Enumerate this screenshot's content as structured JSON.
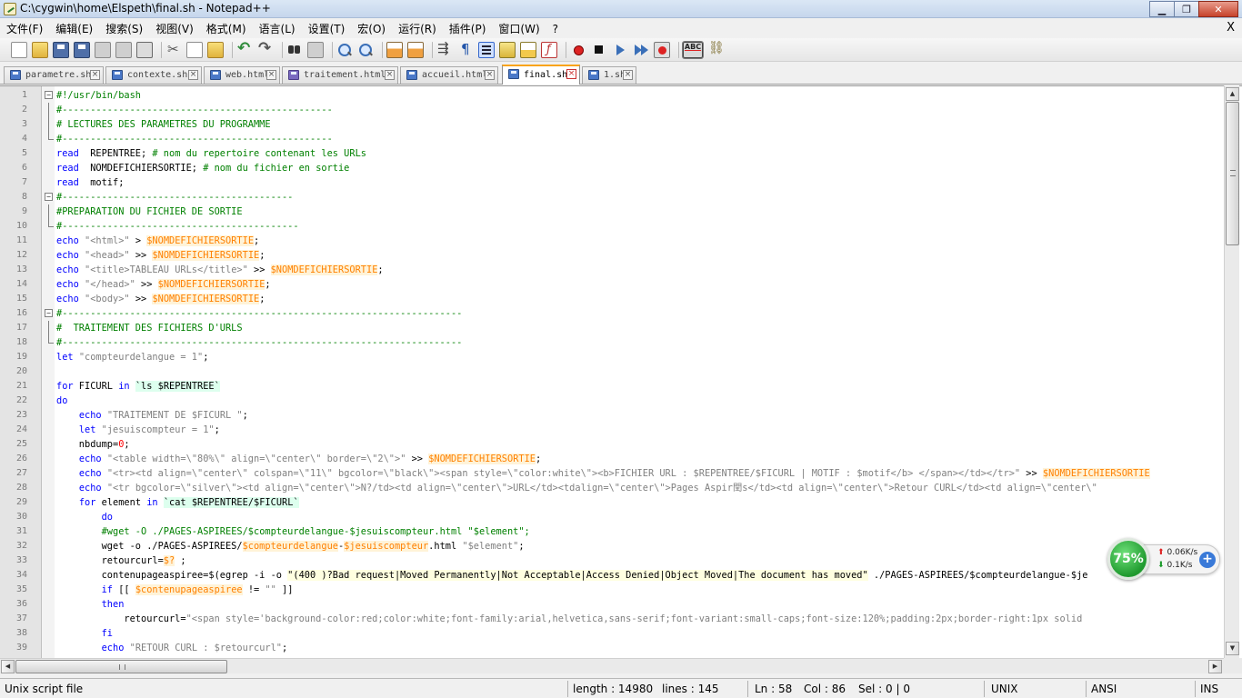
{
  "window": {
    "title": "C:\\cygwin\\home\\Elspeth\\final.sh - Notepad++",
    "minimize_label": "▁",
    "restore_label": "❐",
    "close_label": "✕"
  },
  "menu": {
    "items": [
      "文件(F)",
      "编辑(E)",
      "搜索(S)",
      "视图(V)",
      "格式(M)",
      "语言(L)",
      "设置(T)",
      "宏(O)",
      "运行(R)",
      "插件(P)",
      "窗口(W)",
      "?"
    ],
    "close_doc_label": "X"
  },
  "toolbar": {
    "spell_label": "ABC"
  },
  "tabs": [
    {
      "label": "parametre.sh",
      "active": false
    },
    {
      "label": "contexte.sh",
      "active": false
    },
    {
      "label": "web.html",
      "active": false
    },
    {
      "label": "traitement.html",
      "active": false
    },
    {
      "label": "accueil.html",
      "active": false
    },
    {
      "label": "final.sh",
      "active": true
    },
    {
      "label": "1.sh",
      "active": false
    }
  ],
  "editor": {
    "line_numbers": [
      "1",
      "2",
      "3",
      "4",
      "5",
      "6",
      "7",
      "8",
      "9",
      "10",
      "11",
      "12",
      "13",
      "14",
      "15",
      "16",
      "17",
      "18",
      "19",
      "20",
      "21",
      "22",
      "23",
      "24",
      "25",
      "26",
      "27",
      "28",
      "29",
      "30",
      "31",
      "32",
      "33",
      "34",
      "35",
      "36",
      "37",
      "38",
      "39"
    ],
    "lines": [
      [
        [
          "cm",
          "#!/usr/bin/bash"
        ]
      ],
      [
        [
          "cm",
          "#------------------------------------------------"
        ]
      ],
      [
        [
          "cm",
          "# LECTURES DES PARAMETRES DU PROGRAMME"
        ]
      ],
      [
        [
          "cm",
          "#------------------------------------------------"
        ]
      ],
      [
        [
          "kw",
          "read"
        ],
        [
          "",
          "  REPENTREE; "
        ],
        [
          "cm",
          "# nom du repertoire contenant les URLs"
        ]
      ],
      [
        [
          "kw",
          "read"
        ],
        [
          "",
          "  NOMDEFICHIERSORTIE; "
        ],
        [
          "cm",
          "# nom du fichier en sortie"
        ]
      ],
      [
        [
          "kw",
          "read"
        ],
        [
          "",
          "  motif;"
        ]
      ],
      [
        [
          "cm",
          "#-----------------------------------------"
        ]
      ],
      [
        [
          "cm",
          "#PREPARATION DU FICHIER DE SORTIE"
        ]
      ],
      [
        [
          "cm",
          "#------------------------------------------"
        ]
      ],
      [
        [
          "kw",
          "echo"
        ],
        [
          "",
          " "
        ],
        [
          "st",
          "\"<html>\""
        ],
        [
          "",
          " > "
        ],
        [
          "vr",
          "$NOMDEFICHIERSORTIE"
        ],
        [
          "",
          ";"
        ]
      ],
      [
        [
          "kw",
          "echo"
        ],
        [
          "",
          " "
        ],
        [
          "st",
          "\"<head>\""
        ],
        [
          "",
          " >> "
        ],
        [
          "vr",
          "$NOMDEFICHIERSORTIE"
        ],
        [
          "",
          ";"
        ]
      ],
      [
        [
          "kw",
          "echo"
        ],
        [
          "",
          " "
        ],
        [
          "st",
          "\"<title>TABLEAU URLs</title>\""
        ],
        [
          "",
          " >> "
        ],
        [
          "vr",
          "$NOMDEFICHIERSORTIE"
        ],
        [
          "",
          ";"
        ]
      ],
      [
        [
          "kw",
          "echo"
        ],
        [
          "",
          " "
        ],
        [
          "st",
          "\"</head>\""
        ],
        [
          "",
          " >> "
        ],
        [
          "vr",
          "$NOMDEFICHIERSORTIE"
        ],
        [
          "",
          ";"
        ]
      ],
      [
        [
          "kw",
          "echo"
        ],
        [
          "",
          " "
        ],
        [
          "st",
          "\"<body>\""
        ],
        [
          "",
          " >> "
        ],
        [
          "vr",
          "$NOMDEFICHIERSORTIE"
        ],
        [
          "",
          ";"
        ]
      ],
      [
        [
          "cm",
          "#-----------------------------------------------------------------------"
        ]
      ],
      [
        [
          "cm",
          "#  TRAITEMENT DES FICHIERS D'URLS"
        ]
      ],
      [
        [
          "cm",
          "#-----------------------------------------------------------------------"
        ]
      ],
      [
        [
          "kw",
          "let"
        ],
        [
          "",
          " "
        ],
        [
          "st",
          "\"compteurdelangue = 1\""
        ],
        [
          "",
          ";"
        ]
      ],
      [
        [
          "",
          ""
        ]
      ],
      [
        [
          "kw",
          "for"
        ],
        [
          "",
          " FICURL "
        ],
        [
          "kw",
          "in"
        ],
        [
          "",
          " "
        ],
        [
          "bt",
          "`ls $REPENTREE`"
        ]
      ],
      [
        [
          "kw",
          "do"
        ]
      ],
      [
        [
          "",
          "    "
        ],
        [
          "kw",
          "echo"
        ],
        [
          "",
          " "
        ],
        [
          "st",
          "\"TRAITEMENT DE $FICURL \""
        ],
        [
          "",
          ";"
        ]
      ],
      [
        [
          "",
          "    "
        ],
        [
          "kw",
          "let"
        ],
        [
          "",
          " "
        ],
        [
          "st",
          "\"jesuiscompteur = 1\""
        ],
        [
          "",
          ";"
        ]
      ],
      [
        [
          "",
          "    nbdump="
        ],
        [
          "nm",
          "0"
        ],
        [
          "",
          ";"
        ]
      ],
      [
        [
          "",
          "    "
        ],
        [
          "kw",
          "echo"
        ],
        [
          "",
          " "
        ],
        [
          "st",
          "\"<table width=\\\"80%\\\" align=\\\"center\\\" border=\\\"2\\\">\""
        ],
        [
          "",
          " >> "
        ],
        [
          "vr",
          "$NOMDEFICHIERSORTIE"
        ],
        [
          "",
          ";"
        ]
      ],
      [
        [
          "",
          "    "
        ],
        [
          "kw",
          "echo"
        ],
        [
          "",
          " "
        ],
        [
          "st",
          "\"<tr><td align=\\\"center\\\" colspan=\\\"11\\\" bgcolor=\\\"black\\\"><span style=\\\"color:white\\\"><b>FICHIER URL : $REPENTREE/$FICURL | MOTIF : $motif</b> </span></td></tr>\""
        ],
        [
          "",
          " >> "
        ],
        [
          "vr",
          "$NOMDEFICHIERSORTIE"
        ]
      ],
      [
        [
          "",
          "    "
        ],
        [
          "kw",
          "echo"
        ],
        [
          "",
          " "
        ],
        [
          "st",
          "\"<tr bgcolor=\\\"silver\\\"><td align=\\\"center\\\">N?/td><td align=\\\"center\\\">URL</td><tdalign=\\\"center\\\">Pages Aspir閏s</td><td align=\\\"center\\\">Retour CURL</td><td align=\\\"center\\\""
        ]
      ],
      [
        [
          "",
          "    "
        ],
        [
          "kw",
          "for"
        ],
        [
          "",
          " element "
        ],
        [
          "kw",
          "in"
        ],
        [
          "",
          " "
        ],
        [
          "bt",
          "`cat $REPENTREE/$FICURL`"
        ]
      ],
      [
        [
          "",
          "        "
        ],
        [
          "kw",
          "do"
        ]
      ],
      [
        [
          "",
          "        "
        ],
        [
          "cm",
          "#wget -O ./PAGES-ASPIREES/$compteurdelangue-$jesuiscompteur.html \"$element\";"
        ]
      ],
      [
        [
          "",
          "        wget -o ./PAGES-ASPIREES/"
        ],
        [
          "vr",
          "$compteurdelangue"
        ],
        [
          "",
          "-"
        ],
        [
          "vr",
          "$jesuiscompteur"
        ],
        [
          "",
          ".html "
        ],
        [
          "st",
          "\"$element\""
        ],
        [
          "",
          ";"
        ]
      ],
      [
        [
          "",
          "        retourcurl="
        ],
        [
          "vr",
          "$?"
        ],
        [
          "",
          " ;"
        ]
      ],
      [
        [
          "",
          "        contenupageaspiree=$(egrep -i -o "
        ],
        [
          "bt2",
          "\"(400 )?Bad request|Moved Permanently|Not Acceptable|Access Denied|Object Moved|The document has moved\""
        ],
        [
          "",
          " ./PAGES-ASPIREES/$compteurdelangue-$je"
        ]
      ],
      [
        [
          "",
          "        "
        ],
        [
          "kw",
          "if"
        ],
        [
          "",
          " [[ "
        ],
        [
          "vr",
          "$contenupageaspiree"
        ],
        [
          "",
          " != "
        ],
        [
          "st",
          "\"\""
        ],
        [
          "",
          " ]]"
        ]
      ],
      [
        [
          "",
          "        "
        ],
        [
          "kw",
          "then"
        ]
      ],
      [
        [
          "",
          "            retourcurl="
        ],
        [
          "st",
          "\"<span style='background-color:red;color:white;font-family:arial,helvetica,sans-serif;font-variant:small-caps;font-size:120%;padding:2px;border-right:1px solid"
        ]
      ],
      [
        [
          "",
          "        "
        ],
        [
          "kw",
          "fi"
        ]
      ],
      [
        [
          "",
          "        "
        ],
        [
          "kw",
          "echo"
        ],
        [
          "",
          " "
        ],
        [
          "st",
          "\"RETOUR CURL : $retourcurl\""
        ],
        [
          "",
          ";"
        ]
      ]
    ]
  },
  "status": {
    "file_type": "Unix script file",
    "length": "length : 14980",
    "lines": "lines : 145",
    "ln": "Ln : 58",
    "col": "Col : 86",
    "sel": "Sel : 0 | 0",
    "eol": "UNIX",
    "encoding": "ANSI",
    "mode": "INS"
  },
  "network_widget": {
    "percent": "75%",
    "up": "0.06K/s",
    "down": "0.1K/s",
    "plus": "+"
  },
  "colors": {
    "comment": "#008000",
    "keyword": "#0000ff",
    "variable": "#ff8000",
    "string": "#808080",
    "active_tab_accent": "#f9a31a"
  }
}
